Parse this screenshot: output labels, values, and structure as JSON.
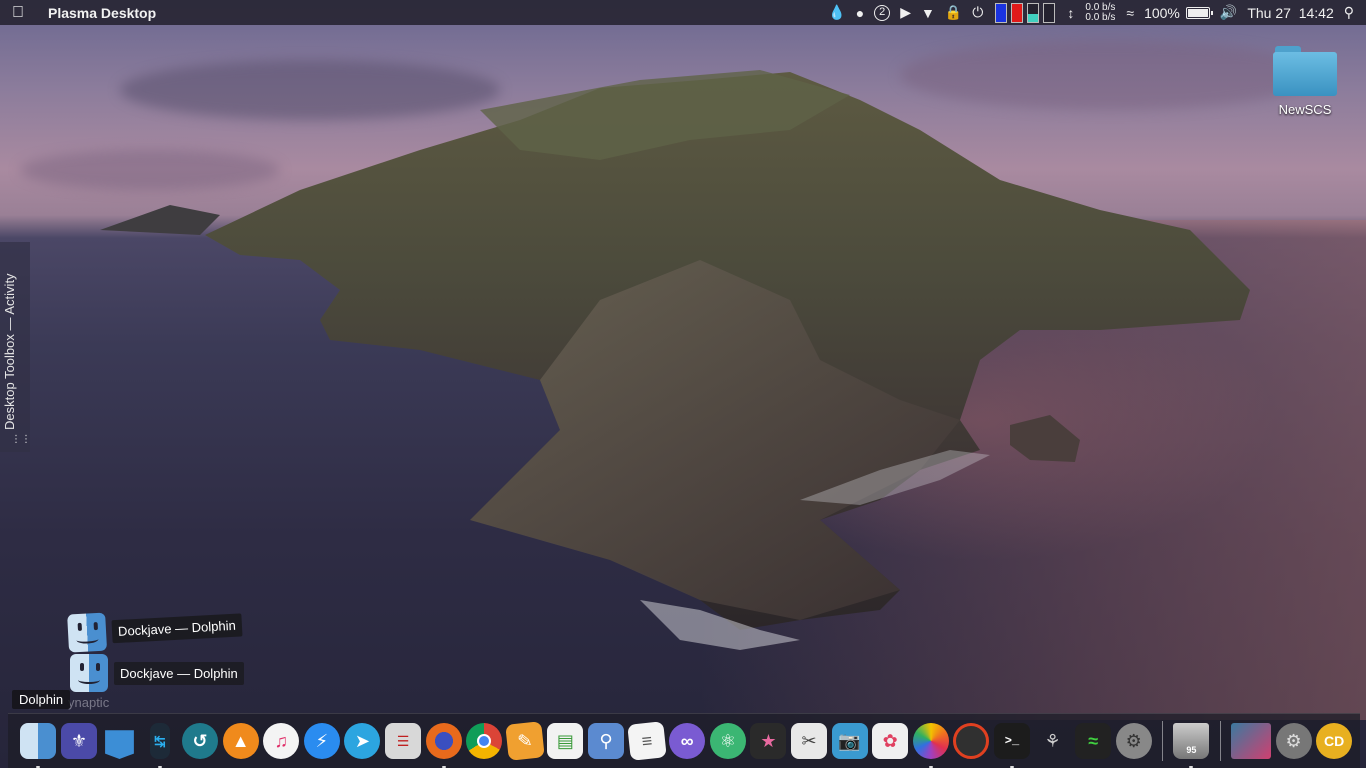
{
  "menubar": {
    "app_title": "Plasma Desktop",
    "badge_number": "2",
    "net_up": "0.0 b/s",
    "net_down": "0.0 b/s",
    "battery_percent": "100%",
    "clock": "Thu 27  14:42"
  },
  "toolbox": {
    "label": "Desktop Toolbox — Activity"
  },
  "desktop": {
    "folder_label": "NewSCS"
  },
  "tasks": [
    {
      "label": "Dockjave — Dolphin"
    },
    {
      "label": "Dockjave — Dolphin"
    }
  ],
  "ghost_label": "ynaptic",
  "tooltip": "Dolphin",
  "trash_count": "95",
  "dock": {
    "apps": [
      {
        "name": "dolphin",
        "color": "#4a8fd0"
      },
      {
        "name": "kde-store",
        "color": "#4b4aa8"
      },
      {
        "name": "files",
        "color": "#3c8ed6"
      },
      {
        "name": "kdeconnect",
        "color": "#1d2a38"
      },
      {
        "name": "kdenlive",
        "color": "#1f7a8c"
      },
      {
        "name": "vlc",
        "color": "#f08a1c"
      },
      {
        "name": "itunes",
        "color": "#f4f4f4"
      },
      {
        "name": "messenger",
        "color": "#2a8cf0"
      },
      {
        "name": "telegram",
        "color": "#2ca5e0"
      },
      {
        "name": "news",
        "color": "#d8d8d8"
      },
      {
        "name": "firefox",
        "color": "#e86a1c"
      },
      {
        "name": "chrome",
        "color": "#e0e0e0"
      },
      {
        "name": "pages",
        "color": "#f0a030"
      },
      {
        "name": "numbers",
        "color": "#f2f2f2"
      },
      {
        "name": "preview",
        "color": "#5b8ad0"
      },
      {
        "name": "textedit",
        "color": "#f4f4f4"
      },
      {
        "name": "visual-studio",
        "color": "#7a5bd2"
      },
      {
        "name": "atom",
        "color": "#3bb673"
      },
      {
        "name": "final-cut",
        "color": "#2a2a2a"
      },
      {
        "name": "screenshot",
        "color": "#e8e8e8"
      },
      {
        "name": "image-capture",
        "color": "#3a9ad0"
      },
      {
        "name": "pixelmator",
        "color": "#f0f0f0"
      },
      {
        "name": "photos",
        "color": "#f2f2f2"
      },
      {
        "name": "photoscape",
        "color": "#303030"
      },
      {
        "name": "terminal",
        "color": "#1c1c1c"
      },
      {
        "name": "scripteditor",
        "color": "#444"
      },
      {
        "name": "activity-monitor",
        "color": "#222"
      },
      {
        "name": "system-preferences",
        "color": "#888"
      }
    ]
  }
}
